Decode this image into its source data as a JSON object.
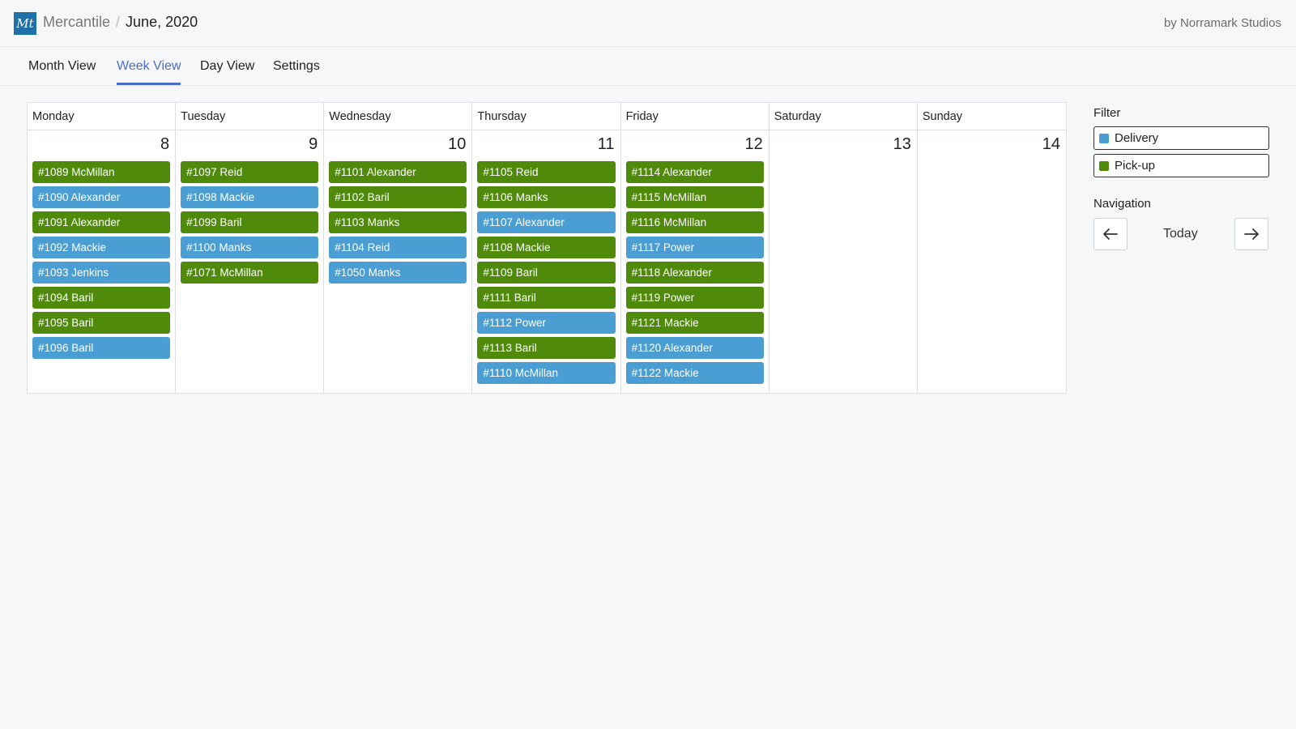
{
  "header": {
    "logo_text": "Mt",
    "app_name": "Mercantile",
    "separator": "/",
    "page_title": "June, 2020",
    "byline": "by Norramark Studios"
  },
  "tabs": [
    "Month View",
    "Week View",
    "Day View",
    "Settings"
  ],
  "active_tab": "Week View",
  "calendar": {
    "days": [
      {
        "name": "Monday",
        "date": "8",
        "events": [
          {
            "label": "#1089 McMillan",
            "type": "pickup"
          },
          {
            "label": "#1090 Alexander",
            "type": "delivery"
          },
          {
            "label": "#1091 Alexander",
            "type": "pickup"
          },
          {
            "label": "#1092 Mackie",
            "type": "delivery"
          },
          {
            "label": "#1093 Jenkins",
            "type": "delivery"
          },
          {
            "label": "#1094 Baril",
            "type": "pickup"
          },
          {
            "label": "#1095 Baril",
            "type": "pickup"
          },
          {
            "label": "#1096 Baril",
            "type": "delivery"
          }
        ]
      },
      {
        "name": "Tuesday",
        "date": "9",
        "events": [
          {
            "label": "#1097 Reid",
            "type": "pickup"
          },
          {
            "label": "#1098 Mackie",
            "type": "delivery"
          },
          {
            "label": "#1099 Baril",
            "type": "pickup"
          },
          {
            "label": "#1100 Manks",
            "type": "delivery"
          },
          {
            "label": "#1071 McMillan",
            "type": "pickup"
          }
        ]
      },
      {
        "name": "Wednesday",
        "date": "10",
        "events": [
          {
            "label": "#1101 Alexander",
            "type": "pickup"
          },
          {
            "label": "#1102 Baril",
            "type": "pickup"
          },
          {
            "label": "#1103 Manks",
            "type": "pickup"
          },
          {
            "label": "#1104 Reid",
            "type": "delivery"
          },
          {
            "label": "#1050 Manks",
            "type": "delivery"
          }
        ]
      },
      {
        "name": "Thursday",
        "date": "11",
        "events": [
          {
            "label": "#1105 Reid",
            "type": "pickup"
          },
          {
            "label": "#1106 Manks",
            "type": "pickup"
          },
          {
            "label": "#1107 Alexander",
            "type": "delivery"
          },
          {
            "label": "#1108 Mackie",
            "type": "pickup"
          },
          {
            "label": "#1109 Baril",
            "type": "pickup"
          },
          {
            "label": "#1111 Baril",
            "type": "pickup"
          },
          {
            "label": "#1112 Power",
            "type": "delivery"
          },
          {
            "label": "#1113 Baril",
            "type": "pickup"
          },
          {
            "label": "#1110 McMillan",
            "type": "delivery"
          }
        ]
      },
      {
        "name": "Friday",
        "date": "12",
        "events": [
          {
            "label": "#1114 Alexander",
            "type": "pickup"
          },
          {
            "label": "#1115 McMillan",
            "type": "pickup"
          },
          {
            "label": "#1116 McMillan",
            "type": "pickup"
          },
          {
            "label": "#1117 Power",
            "type": "delivery"
          },
          {
            "label": "#1118 Alexander",
            "type": "pickup"
          },
          {
            "label": "#1119 Power",
            "type": "pickup"
          },
          {
            "label": "#1121 Mackie",
            "type": "pickup"
          },
          {
            "label": "#1120 Alexander",
            "type": "delivery"
          },
          {
            "label": "#1122 Mackie",
            "type": "delivery"
          }
        ]
      },
      {
        "name": "Saturday",
        "date": "13",
        "events": []
      },
      {
        "name": "Sunday",
        "date": "14",
        "events": []
      }
    ]
  },
  "sidebar": {
    "filter_title": "Filter",
    "filters": [
      {
        "label": "Delivery",
        "color": "#4a9ed4"
      },
      {
        "label": "Pick-up",
        "color": "#4f8a0b"
      }
    ],
    "navigation_title": "Navigation",
    "today_label": "Today",
    "prev_icon": "arrow-left-icon",
    "next_icon": "arrow-right-icon"
  },
  "colors": {
    "accent": "#4b6cc7",
    "delivery": "#4a9ed4",
    "pickup": "#4f8a0b",
    "logo_bg": "#1f6fa8"
  }
}
